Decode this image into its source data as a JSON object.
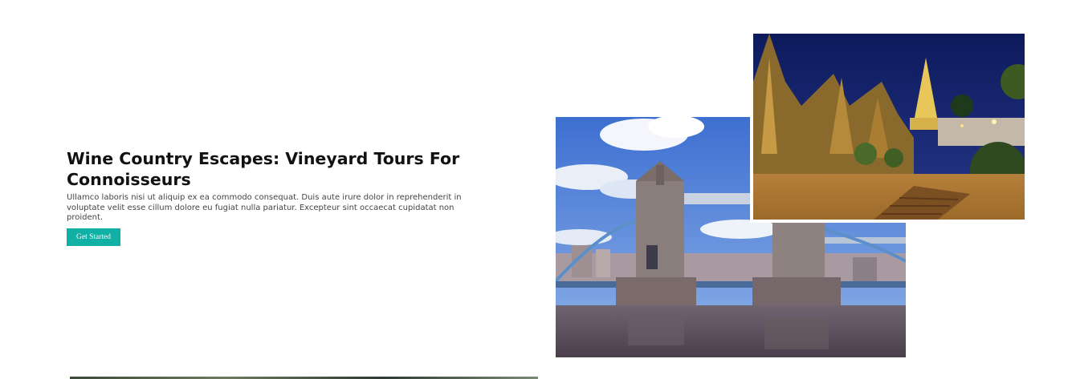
{
  "hero": {
    "title": "Wine Country Escapes: Vineyard Tours For Connoisseurs",
    "description": "Ullamco laboris nisi ut aliquip ex ea commodo consequat. Duis aute irure dolor in reprehenderit in voluptate velit esse cillum dolore eu fugiat nulla pariatur. Excepteur sint occaecat cupidatat non proident.",
    "cta_label": "Get Started"
  },
  "colors": {
    "accent": "#10b0a4",
    "title": "#111111",
    "body_text": "#444444",
    "background": "#ffffff"
  },
  "images": [
    {
      "name": "tower-bridge-photo"
    },
    {
      "name": "golden-pagoda-temple-photo"
    }
  ]
}
